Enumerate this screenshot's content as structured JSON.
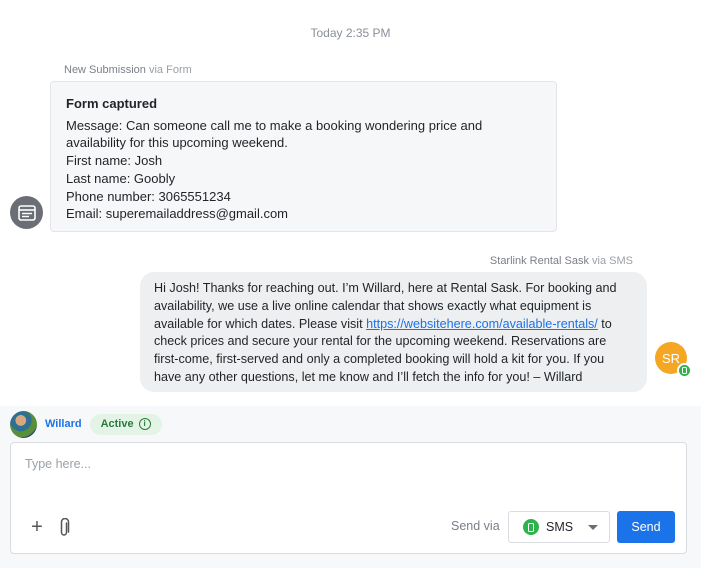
{
  "thread": {
    "timestamp": "Today 2:35 PM",
    "form_message": {
      "source": "New Submission",
      "via": "via Form",
      "title": "Form captured",
      "lines": [
        "Message: Can someone call me to make a booking wondering price and availability for this upcoming weekend.",
        "First name: Josh",
        "Last name: Goobly",
        "Phone number: 3065551234",
        "Email: superemailaddress@gmail.com"
      ],
      "icon": "form-icon"
    },
    "sms_message": {
      "sender": "Starlink Rental Sask",
      "via": "via SMS",
      "text_before_link": "Hi Josh! Thanks for reaching out. I’m Willard, here at Rental Sask. For booking and availability, we use a live online calendar that shows exactly what equipment is available for which dates. Please visit ",
      "link": "https://websitehere.com/available-rentals/",
      "text_after_link": " to check prices and secure your rental for the upcoming weekend. Reservations are first-come, first-served and only a completed booking will hold a kit for you. If you have any other questions, let me know and I’ll fetch the info for you! – Willard",
      "avatar_initials": "SR",
      "avatar_color": "#f5a623",
      "badge_color": "#2eb24d"
    }
  },
  "composer": {
    "agent_name": "Willard",
    "status": "Active",
    "placeholder": "Type here...",
    "send_via_label": "Send via",
    "channel": "SMS",
    "send_label": "Send",
    "accent_color": "#1a73e8"
  }
}
